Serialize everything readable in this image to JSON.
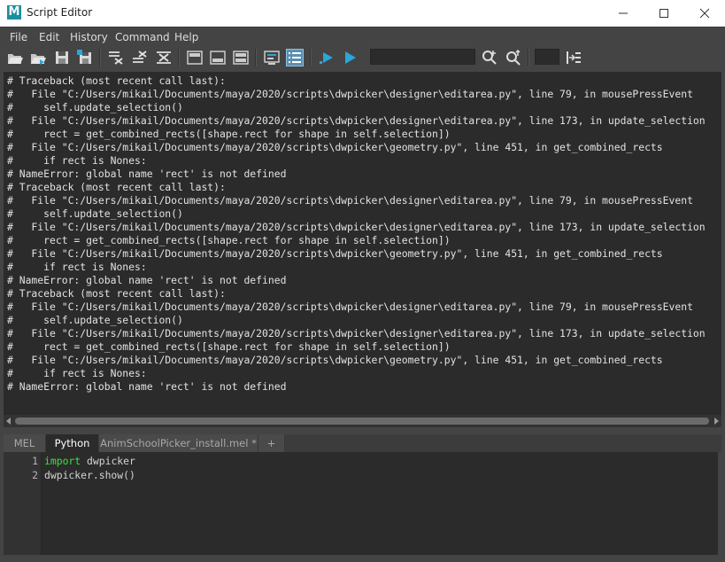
{
  "window": {
    "title": "Script Editor",
    "app_icon_letter": "M",
    "controls": [
      "minimize-icon",
      "maximize-icon",
      "close-icon"
    ]
  },
  "menu": [
    "File",
    "Edit",
    "History",
    "Command",
    "Help"
  ],
  "toolbar": {
    "icons": [
      "open-script-icon",
      "source-script-icon",
      "save-script-icon",
      "save-script-to-shelf-icon",
      "clear-history-icon",
      "clear-input-icon",
      "clear-all-icon",
      "show-history-only-icon",
      "show-input-only-icon",
      "show-both-icon",
      "echo-all-commands-icon",
      "show-line-numbers-icon",
      "execute-all-icon",
      "execute-icon",
      "search-icon",
      "search-next-icon",
      "goto-line-icon"
    ],
    "search_value": "",
    "line_value": ""
  },
  "output": {
    "lines": [
      "# Traceback (most recent call last):",
      "#   File \"C:/Users/mikail/Documents/maya/2020/scripts\\dwpicker\\designer\\editarea.py\", line 79, in mousePressEvent",
      "#     self.update_selection()",
      "#   File \"C:/Users/mikail/Documents/maya/2020/scripts\\dwpicker\\designer\\editarea.py\", line 173, in update_selection",
      "#     rect = get_combined_rects([shape.rect for shape in self.selection])",
      "#   File \"C:/Users/mikail/Documents/maya/2020/scripts\\dwpicker\\geometry.py\", line 451, in get_combined_rects",
      "#     if rect is Nones:",
      "# NameError: global name 'rect' is not defined",
      "# Traceback (most recent call last):",
      "#   File \"C:/Users/mikail/Documents/maya/2020/scripts\\dwpicker\\designer\\editarea.py\", line 79, in mousePressEvent",
      "#     self.update_selection()",
      "#   File \"C:/Users/mikail/Documents/maya/2020/scripts\\dwpicker\\designer\\editarea.py\", line 173, in update_selection",
      "#     rect = get_combined_rects([shape.rect for shape in self.selection])",
      "#   File \"C:/Users/mikail/Documents/maya/2020/scripts\\dwpicker\\geometry.py\", line 451, in get_combined_rects",
      "#     if rect is Nones:",
      "# NameError: global name 'rect' is not defined",
      "# Traceback (most recent call last):",
      "#   File \"C:/Users/mikail/Documents/maya/2020/scripts\\dwpicker\\designer\\editarea.py\", line 79, in mousePressEvent",
      "#     self.update_selection()",
      "#   File \"C:/Users/mikail/Documents/maya/2020/scripts\\dwpicker\\designer\\editarea.py\", line 173, in update_selection",
      "#     rect = get_combined_rects([shape.rect for shape in self.selection])",
      "#   File \"C:/Users/mikail/Documents/maya/2020/scripts\\dwpicker\\geometry.py\", line 451, in get_combined_rects",
      "#     if rect is Nones:",
      "# NameError: global name 'rect' is not defined"
    ]
  },
  "tabs": [
    {
      "label": "MEL",
      "active": false
    },
    {
      "label": "Python",
      "active": true
    },
    {
      "label": "AnimSchoolPicker_install.mel *",
      "active": false
    },
    {
      "label": "+",
      "active": false
    }
  ],
  "editor": {
    "lines": [
      {
        "number": "1",
        "keyword": "import",
        "rest": " dwpicker"
      },
      {
        "number": "2",
        "keyword": "",
        "rest": "dwpicker.show()"
      }
    ]
  },
  "colors": {
    "keyword": "#39e339",
    "background": "#444444",
    "panel": "#2b2b2b",
    "accent_icon": "#2aa6d8"
  }
}
